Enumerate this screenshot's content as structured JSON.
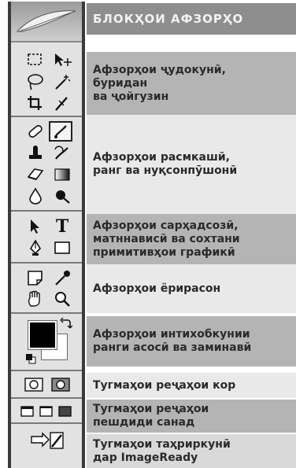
{
  "title": "БЛОКҲОИ АФЗОРҲО",
  "sections": [
    {
      "text": "Афзорҳои ҷудокунӣ,\nбуридан\nва ҷойгузин"
    },
    {
      "text": "Афзорҳои расмкашӣ,\nранг ва нуқсонпӯшонӣ"
    },
    {
      "text": "Афзорҳои сарҳадсозӣ,\nматннависӣ ва сохтани\nпримитивҳои графикӣ"
    },
    {
      "text": "Афзорҳои ёрирасон"
    },
    {
      "text": "Афзорҳои интихобкунии\nранги асосӣ ва заминавӣ"
    },
    {
      "text": "Тугмаҳои реҷаҳои кор"
    },
    {
      "text": "Тугмаҳои реҷаҳои\nпешдиди санад"
    },
    {
      "text": "Тугмаҳои таҳриркунӣ\nдар ImageReady"
    }
  ],
  "toolbar": {
    "tools": [
      "rect-marquee",
      "move",
      "lasso",
      "magic-wand",
      "crop",
      "slice",
      "healing-brush",
      "brush",
      "clone-stamp",
      "history-brush",
      "eraser",
      "gradient",
      "blur",
      "dodge",
      "path-select",
      "type",
      "pen",
      "shape",
      "notes",
      "eyedropper",
      "hand",
      "zoom"
    ],
    "type_glyph": "T",
    "colors": {
      "foreground": "#000000",
      "background": "#ffffff"
    }
  }
}
